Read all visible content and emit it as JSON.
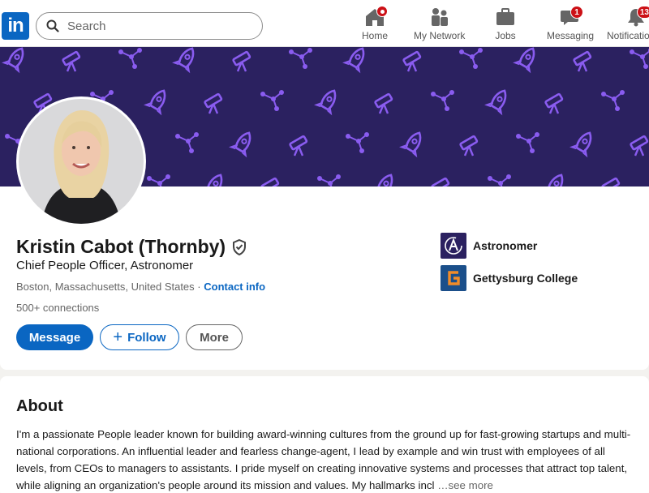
{
  "nav": {
    "logo": "in",
    "search_placeholder": "Search",
    "items": [
      {
        "label": "Home",
        "icon": "home-icon",
        "badge": ""
      },
      {
        "label": "My Network",
        "icon": "network-icon",
        "badge": ""
      },
      {
        "label": "Jobs",
        "icon": "briefcase-icon",
        "badge": ""
      },
      {
        "label": "Messaging",
        "icon": "messaging-icon",
        "badge": "1"
      },
      {
        "label": "Notifications",
        "icon": "bell-icon",
        "badge": "13"
      }
    ]
  },
  "profile": {
    "name": "Kristin Cabot (Thornby)",
    "headline": "Chief People Officer, Astronomer",
    "location": "Boston, Massachusetts, United States",
    "location_sep": " · ",
    "contact_info": "Contact info",
    "connections": "500+ connections",
    "buttons": {
      "message": "Message",
      "follow": "Follow",
      "follow_icon": "+",
      "more": "More"
    },
    "organizations": [
      {
        "name": "Astronomer",
        "logo": "astronomer-logo",
        "color": "#2b2160"
      },
      {
        "name": "Gettysburg College",
        "logo": "gettysburg-logo",
        "color": "#1b4f8a"
      }
    ]
  },
  "about": {
    "title": "About",
    "text": "I'm a passionate People leader known for building award-winning cultures from the ground up for fast-growing startups and multi-national corporations. An influential leader and fearless change-agent, I lead by example and win trust with employees of all levels, from CEOs to managers to assistants. I pride myself on creating innovative systems and processes that attract top talent, while aligning an organization's people around its mission and values. My hallmarks incl",
    "see_more": "…see more"
  },
  "colors": {
    "brand": "#0a66c2",
    "banner": "#2b2160",
    "banner_pattern": "#8a5cf0",
    "badge": "#cc1016"
  }
}
